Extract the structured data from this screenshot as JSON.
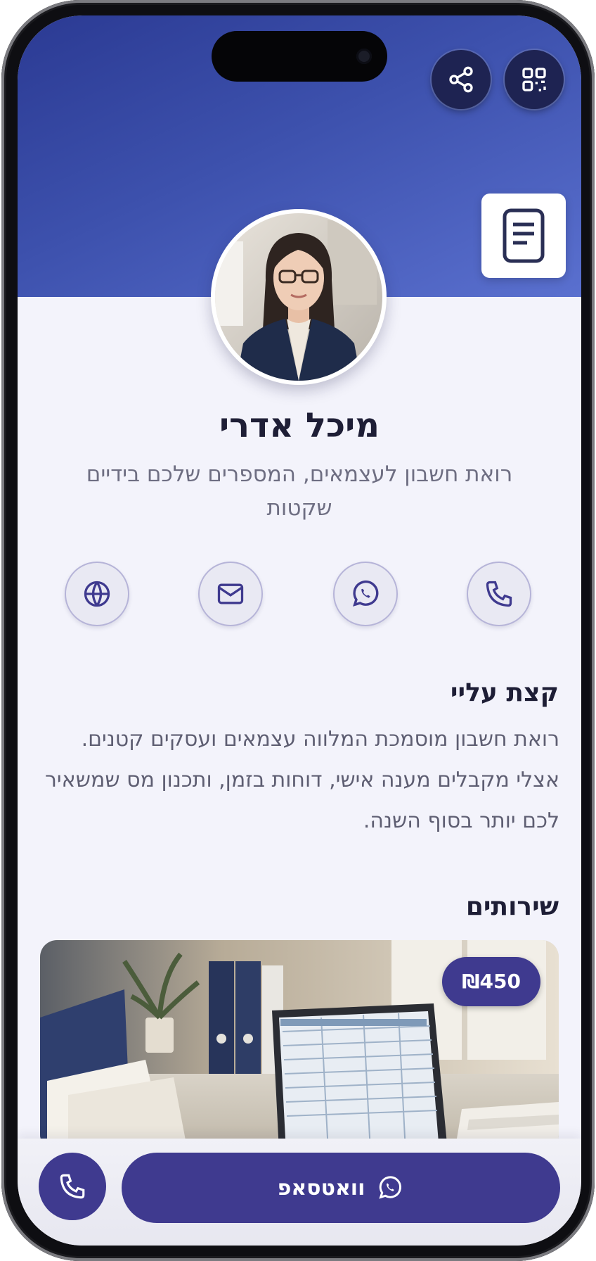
{
  "colors": {
    "header_gradient_start": "#2b3a93",
    "header_gradient_end": "#5a70cf",
    "accent": "#3f3a8f",
    "background": "#f3f3fb",
    "text_dark": "#1e1e36",
    "text_muted": "#6e6e82"
  },
  "header": {
    "icons": [
      "share-icon",
      "qr-code-icon",
      "document-icon"
    ]
  },
  "profile": {
    "name": "מיכל אדרי",
    "tagline": "רואת חשבון לעצמאים, המספרים שלכם בידיים שקטות",
    "avatar_icon": "profile-photo"
  },
  "contacts": [
    {
      "icon": "phone-icon"
    },
    {
      "icon": "whatsapp-icon"
    },
    {
      "icon": "mail-icon"
    },
    {
      "icon": "globe-icon"
    }
  ],
  "about": {
    "title": "קצת עליי",
    "text": "רואת חשבון מוסמכת המלווה עצמאים ועסקים קטנים. אצלי מקבלים מענה אישי, דוחות בזמן, ותכנון מס שמשאיר לכם יותר בסוף השנה."
  },
  "services": {
    "title": "שירותים",
    "items": [
      {
        "price": "₪450",
        "image": "office-desk-laptop-photo"
      }
    ]
  },
  "bottom_bar": {
    "whatsapp_label": "וואטסאפ",
    "call_icon": "phone-icon"
  }
}
